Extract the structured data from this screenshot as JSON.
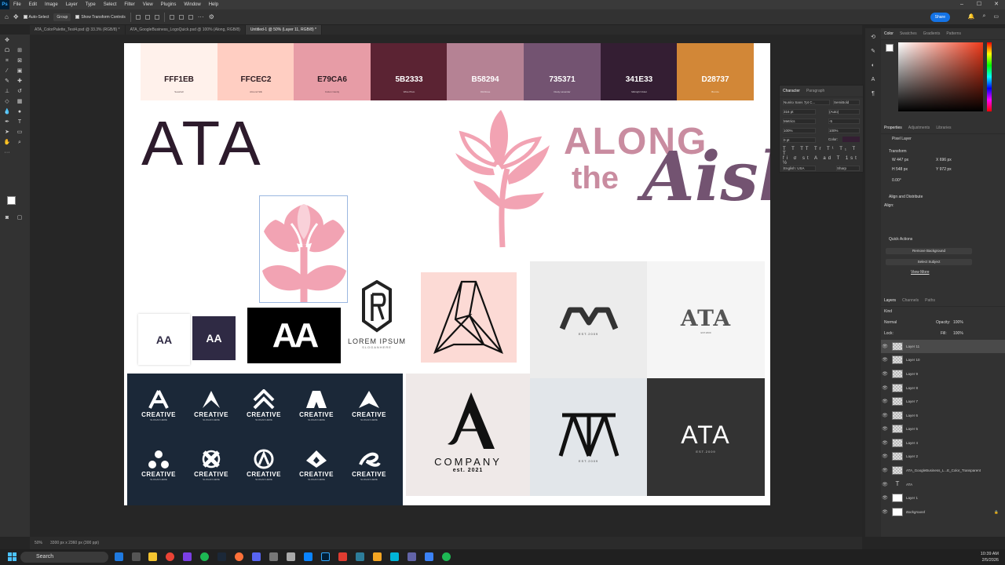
{
  "menubar": {
    "app_icon": "Ps",
    "items": [
      "File",
      "Edit",
      "Image",
      "Layer",
      "Type",
      "Select",
      "Filter",
      "View",
      "Plugins",
      "Window",
      "Help"
    ]
  },
  "optionsbar": {
    "auto_select": "Auto-Select",
    "group": "Group",
    "show_transform": "Show Transform Controls",
    "share": "Share"
  },
  "tabs": [
    "ATA_ColorPalette_Test4.psd @ 33.3% (RGB/8) *",
    "ATA_GoogleBusiness_LogoQuick.psd @ 100% (Along, RGB/8)",
    "Untitled-1 @ 50% (Layer 11, RGB/8) *"
  ],
  "palette": [
    {
      "hex": "FFF1EB",
      "name": "Seashell",
      "bg": "#FFF1EB",
      "fg": "#2b1a20"
    },
    {
      "hex": "FFCEC2",
      "name": "Almond Silk",
      "bg": "#FFCEC2",
      "fg": "#2b1a20"
    },
    {
      "hex": "E79CA6",
      "name": "Cotton Candy",
      "bg": "#E79CA6",
      "fg": "#2b1a20"
    },
    {
      "hex": "5B2333",
      "name": "Wine Plum",
      "bg": "#5B2333",
      "fg": "#ffffff"
    },
    {
      "hex": "B58294",
      "name": "Old Rose",
      "bg": "#B58294",
      "fg": "#ffffff"
    },
    {
      "hex": "735371",
      "name": "Dusty Lavender",
      "bg": "#735371",
      "fg": "#ffffff"
    },
    {
      "hex": "341E33",
      "name": "Midnight Violet",
      "bg": "#341E33",
      "fg": "#ffffff"
    },
    {
      "hex": "D28737",
      "name": "Bronze",
      "bg": "#D28737",
      "fg": "#ffffff"
    }
  ],
  "canvas": {
    "big_title": "ATA",
    "along_logo": {
      "line1": "ALONG",
      "line2": "the",
      "line3": "Aisle"
    },
    "lorem": {
      "title": "LOREM IPSUM",
      "sub": "SLOGANHERE"
    },
    "creative": {
      "word": "CREATIVE",
      "slogan": "SLOGAN HERE",
      "count": 10
    },
    "company": {
      "word": "COMPANY",
      "est": "est. 2021"
    },
    "ata_logo2_est": "EST.2009",
    "ata_logo3_est": "EST.2009",
    "ata_dark": "ATA",
    "ata_dark_est": "EST.2009",
    "ata_ornate": "ATA",
    "ata_ornate_sub": "EST.2009",
    "aa_small": "AA",
    "aa_big": "AA"
  },
  "status": {
    "zoom": "50%",
    "doc_size": "3300 px x 2360 px (300 ppi)"
  },
  "color_panel": {
    "tabs": [
      "Color",
      "Swatches",
      "Gradients",
      "Patterns"
    ]
  },
  "character_panel": {
    "tabs": [
      "Character",
      "Paragraph"
    ],
    "font": "Nunito Sans 7pt C...",
    "style": "SemiBold",
    "size": "316 pt",
    "leading": "(Auto)",
    "kerning": "Metrics",
    "tracking": "-5",
    "scale_v": "100%",
    "scale_h": "100%",
    "baseline": "0 pt",
    "color_label": "Color:",
    "language": "English: USA",
    "aa": "Sharp"
  },
  "properties_panel": {
    "tabs": [
      "Properties",
      "Adjustments",
      "Libraries"
    ],
    "layer_type": "Pixel Layer",
    "transform": "Transform",
    "w": "447 px",
    "h": "548 px",
    "x": "696 px",
    "y": "972 px",
    "angle": "0.00°",
    "align_dist": "Align and Distribute",
    "align": "Align:",
    "quick_actions": "Quick Actions",
    "remove_bg": "Remove Background",
    "select_subject": "Select Subject",
    "view_more": "View More"
  },
  "layers_panel": {
    "tabs": [
      "Layers",
      "Channels",
      "Paths"
    ],
    "kind": "Kind",
    "blend": "Normal",
    "opacity_label": "Opacity:",
    "opacity": "100%",
    "fill_label": "Fill:",
    "fill": "100%",
    "lock": "Lock:",
    "layers": [
      "Layer 11",
      "Layer 10",
      "Layer 9",
      "Layer 8",
      "Layer 7",
      "Layer 6",
      "Layer 5",
      "Layer 4",
      "Layer 2",
      "ATA_GoogleBusiness_L...E_Color_Transparent",
      "ATA",
      "Layer 1",
      "Background"
    ]
  },
  "taskbar": {
    "search": "Search",
    "time": "10:39 AM",
    "date": "2/5/2026"
  }
}
